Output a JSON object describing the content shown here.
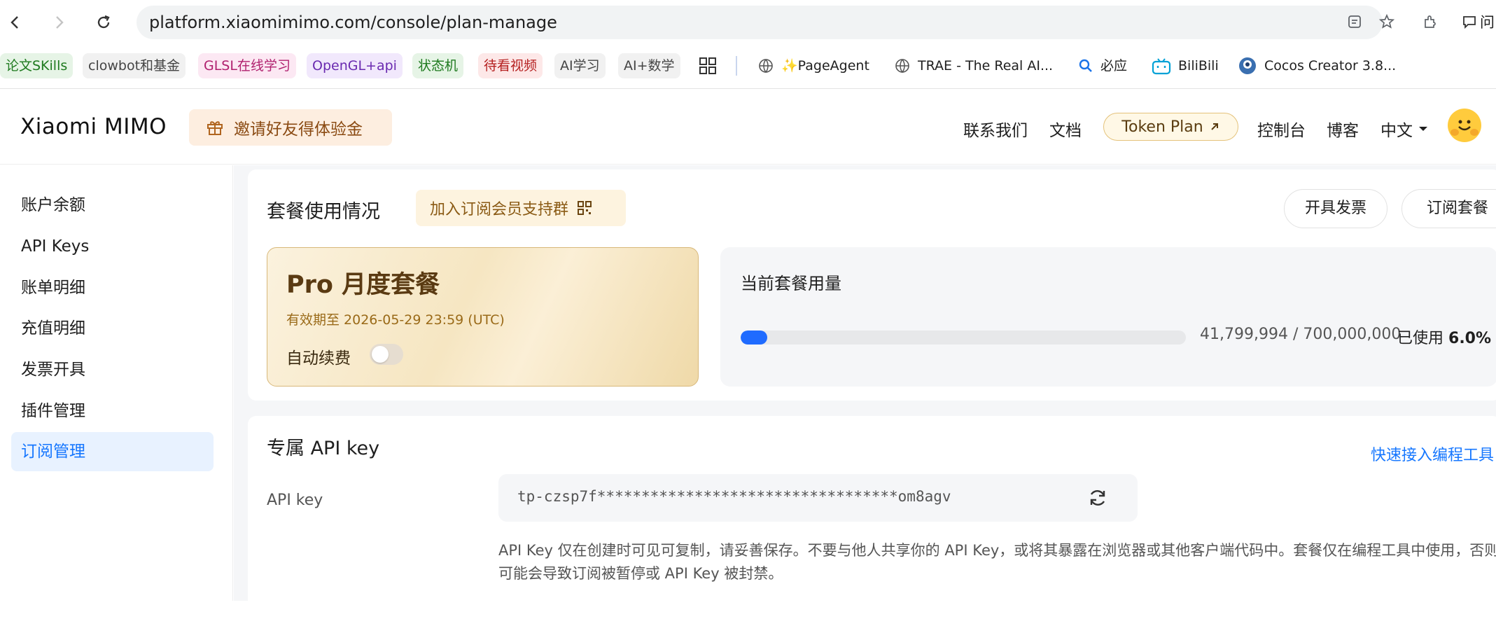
{
  "browser": {
    "url": "platform.xiaomimimo.com/console/plan-manage",
    "bookmarks": [
      {
        "label": "论文SKills",
        "bg": "#e6f4e6",
        "fg": "#1f7a1f"
      },
      {
        "label": "clowbot和基金",
        "bg": "#f1f1f1",
        "fg": "#444444"
      },
      {
        "label": "GLSL在线学习",
        "bg": "#fce8f3",
        "fg": "#b0206e"
      },
      {
        "label": "OpenGL+api",
        "bg": "#f1e8fc",
        "fg": "#6a2ab0"
      },
      {
        "label": "状态机",
        "bg": "#e6f4e6",
        "fg": "#1f7a1f"
      },
      {
        "label": "待看视频",
        "bg": "#fde8e8",
        "fg": "#b52020"
      },
      {
        "label": "AI学习",
        "bg": "#f1f1f1",
        "fg": "#444444"
      },
      {
        "label": "AI+数学",
        "bg": "#f1f1f1",
        "fg": "#444444"
      }
    ],
    "links": [
      "✨PageAgent",
      "TRAE - The Real AI...",
      "必应",
      "BiliBili",
      "Cocos Creator 3.8..."
    ],
    "right_label": "问"
  },
  "header": {
    "logo": "Xiaomi MIMO",
    "invite": "邀请好友得体验金",
    "nav": [
      "联系我们",
      "文档",
      "控制台",
      "博客"
    ],
    "token_plan": "Token Plan",
    "lang": "中文"
  },
  "sidebar": {
    "items": [
      "账户余额",
      "API Keys",
      "账单明细",
      "充值明细",
      "发票开具",
      "插件管理",
      "订阅管理"
    ],
    "active_index": 6
  },
  "plan_section": {
    "title": "套餐使用情况",
    "join_group": "加入订阅会员支持群",
    "invoice_button": "开具发票",
    "subscribe_button": "订阅套餐",
    "plan_name": "Pro 月度套餐",
    "expiry": "有效期至 2026-05-29 23:59 (UTC)",
    "auto_renew_label": "自动续费",
    "auto_renew": false,
    "usage_title": "当前套餐用量",
    "usage_value": "41,799,994 / 700,000,000",
    "usage_used_label": "已使用",
    "usage_percent_text": "6.0%",
    "usage_fraction": 0.06
  },
  "api_section": {
    "title": "专属 API key",
    "quick_link": "快速接入编程工具",
    "key_label": "API key",
    "key_value": "tp-czsp7f**********************************om8agv",
    "note": "API Key 仅在创建时可见可复制，请妥善保存。不要与他人共享你的 API Key，或将其暴露在浏览器或其他客户端代码中。套餐仅在编程工具中使用，否则可能会导致订阅被暂停或 API Key 被封禁。"
  },
  "colors": {
    "accent": "#1677ff",
    "progress": "#1f6bff",
    "gold_border": "#d8b87a"
  }
}
